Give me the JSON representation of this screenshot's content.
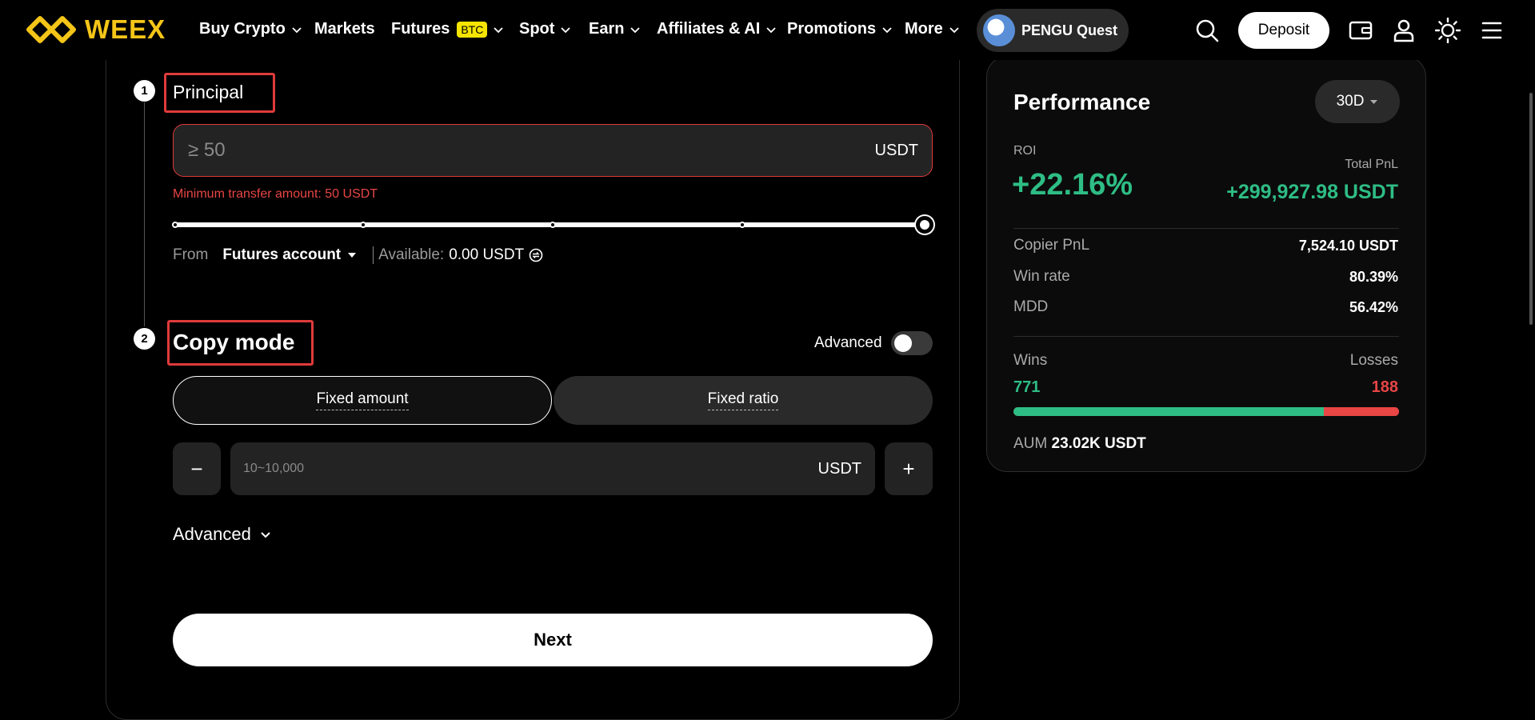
{
  "nav": {
    "logo_text": "WEEX",
    "items": [
      {
        "label": "Buy Crypto",
        "has_chevron": true
      },
      {
        "label": "Markets",
        "has_chevron": false
      },
      {
        "label": "Futures",
        "badge": "BTC",
        "has_chevron": true
      },
      {
        "label": "Spot",
        "has_chevron": true
      },
      {
        "label": "Earn",
        "has_chevron": true
      },
      {
        "label": "Affiliates & AI",
        "has_chevron": true
      },
      {
        "label": "Promotions",
        "has_chevron": true
      },
      {
        "label": "More",
        "has_chevron": true
      }
    ],
    "promo_label": "PENGU Quest",
    "deposit_label": "Deposit",
    "icons": [
      "search-icon",
      "wallet-icon",
      "user-icon",
      "theme-sun-icon",
      "menu-icon"
    ]
  },
  "form": {
    "step1": {
      "number": "1",
      "title": "Principal"
    },
    "amount_input": {
      "placeholder": "≥ 50",
      "value": "",
      "unit": "USDT"
    },
    "error_text": "Minimum transfer amount: 50 USDT",
    "slider": {
      "value_percent": 100,
      "marks_percent": [
        0,
        25,
        50,
        75,
        100
      ]
    },
    "from_label": "From",
    "from_account": "Futures account",
    "available_label": "Available:",
    "available_value": "0.00 USDT",
    "step2": {
      "number": "2",
      "title": "Copy mode"
    },
    "advanced_toggle_label": "Advanced",
    "advanced_toggle_on": false,
    "modes": [
      {
        "label": "Fixed amount",
        "selected": true
      },
      {
        "label": "Fixed ratio",
        "selected": false
      }
    ],
    "fixed_input": {
      "placeholder": "10~10,000",
      "value": "",
      "unit": "USDT"
    },
    "minus_label": "−",
    "plus_label": "+",
    "advanced_expand_label": "Advanced",
    "next_label": "Next"
  },
  "performance": {
    "title": "Performance",
    "period": "30D",
    "roi_label": "ROI",
    "roi_value": "+22.16%",
    "total_pnl_label": "Total PnL",
    "total_pnl_value": "+299,927.98 USDT",
    "stats": [
      {
        "label": "Copier PnL",
        "value": "7,524.10 USDT"
      },
      {
        "label": "Win rate",
        "value": "80.39%"
      },
      {
        "label": "MDD",
        "value": "56.42%"
      }
    ],
    "wins_label": "Wins",
    "losses_label": "Losses",
    "wins_value": "771",
    "losses_value": "188",
    "aum_label": "AUM",
    "aum_value": "23.02K USDT"
  },
  "colors": {
    "accent_brand": "#f5c518",
    "positive": "#2ebd85",
    "negative": "#e84545",
    "highlight_box": "#e03b3b"
  }
}
